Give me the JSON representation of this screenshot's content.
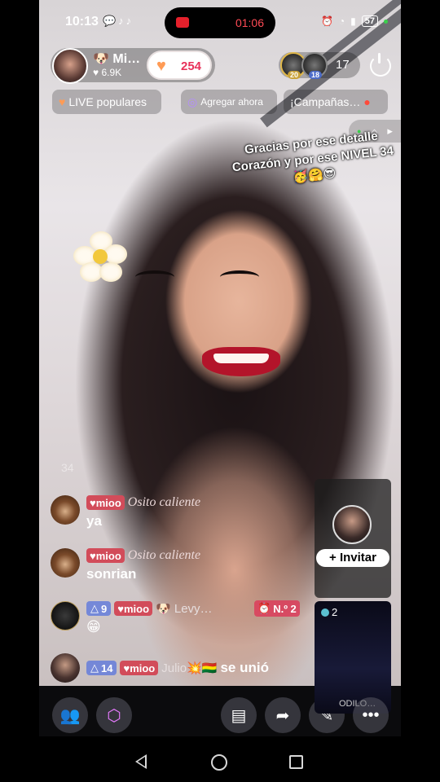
{
  "status_bar": {
    "time": "10:13",
    "app_icons": "💬♪♪",
    "recording_time": "01:06",
    "battery": "57"
  },
  "host": {
    "name": "🐶 Mi…",
    "fans": "♥ 6.9K",
    "likes": "254"
  },
  "viewers": {
    "avatar1_level": "20",
    "avatar2_level": "18",
    "count": "17"
  },
  "chips": [
    {
      "label": "LIVE populares"
    },
    {
      "label": "Agregar ahora"
    },
    {
      "label": "¡Campañas…"
    }
  ],
  "overlay_text": "Gracias por ese detalle Corazón y por ese NIVEL 34🥳🤗😎",
  "chat": {
    "faded": "34",
    "messages": [
      {
        "badge": "mioo",
        "user": "Osito caliente",
        "text": "ya"
      },
      {
        "badge": "mioo",
        "user": "Osito caliente",
        "text": "sonrian"
      },
      {
        "level": "9",
        "badge": "mioo",
        "user": "🐶 Levy…",
        "text": "😁",
        "rank": "N.º 2"
      },
      {
        "level": "14",
        "badge": "mioo",
        "user": "Julio💥🇧🇴",
        "text": "se unió"
      }
    ]
  },
  "invite": {
    "label": "Invitar"
  },
  "guest": {
    "count": "2",
    "label": "ODILO…"
  },
  "colors": {
    "accent_red": "#e8325a",
    "badge_mioo": "#d24c5a",
    "level_blue": "#5e78dc"
  }
}
